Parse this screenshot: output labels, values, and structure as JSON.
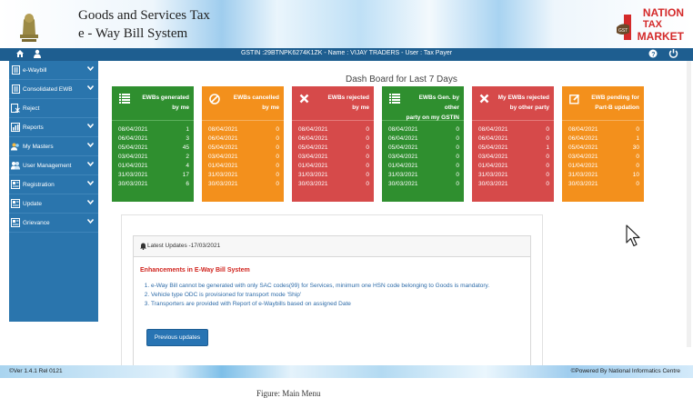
{
  "header": {
    "title_line1": "Goods and Services Tax",
    "title_line2": "e - Way Bill System",
    "logo": {
      "line1": "NATION",
      "line2": "TAX",
      "line3": "MARKET",
      "badge": "GST"
    }
  },
  "navbar": {
    "gstin_info": "GSTIN :29BTNPK6274K1ZK - Name : VIJAY TRADERS - User : Tax Payer",
    "icons": [
      "home-icon",
      "user-icon",
      "help-icon",
      "power-icon"
    ]
  },
  "sidebar": {
    "items": [
      {
        "label": "e-Waybill",
        "icon": "document-icon",
        "chevron": true
      },
      {
        "label": "Consolidated EWB",
        "icon": "document-icon",
        "chevron": true
      },
      {
        "label": "Reject",
        "icon": "reject-icon",
        "chevron": false
      },
      {
        "label": "Reports",
        "icon": "report-icon",
        "chevron": true
      },
      {
        "label": "My Masters",
        "icon": "masters-icon",
        "chevron": true
      },
      {
        "label": "User Management",
        "icon": "users-icon",
        "chevron": true
      },
      {
        "label": "Registration",
        "icon": "registration-icon",
        "chevron": true
      },
      {
        "label": "Update",
        "icon": "update-icon",
        "chevron": true
      },
      {
        "label": "Grievance",
        "icon": "grievance-icon",
        "chevron": true
      }
    ]
  },
  "dashboard": {
    "title": "Dash Board for Last 7 Days",
    "cards": [
      {
        "title_line1": "EWBs generated",
        "title_line2": "by me",
        "color": "#2f8f2f",
        "icon": "list-icon",
        "rows": [
          [
            "08/04/2021",
            "1"
          ],
          [
            "06/04/2021",
            "3"
          ],
          [
            "05/04/2021",
            "45"
          ],
          [
            "03/04/2021",
            "2"
          ],
          [
            "01/04/2021",
            "4"
          ],
          [
            "31/03/2021",
            "17"
          ],
          [
            "30/03/2021",
            "6"
          ]
        ]
      },
      {
        "title_line1": "EWBs cancelled",
        "title_line2": "by me",
        "color": "#f3901c",
        "icon": "cancel-icon",
        "rows": [
          [
            "08/04/2021",
            "0"
          ],
          [
            "06/04/2021",
            "0"
          ],
          [
            "05/04/2021",
            "0"
          ],
          [
            "03/04/2021",
            "0"
          ],
          [
            "01/04/2021",
            "0"
          ],
          [
            "31/03/2021",
            "0"
          ],
          [
            "30/03/2021",
            "0"
          ]
        ]
      },
      {
        "title_line1": "EWBs rejected",
        "title_line2": "by me",
        "color": "#d64a4a",
        "icon": "x-icon",
        "rows": [
          [
            "08/04/2021",
            "0"
          ],
          [
            "06/04/2021",
            "0"
          ],
          [
            "05/04/2021",
            "0"
          ],
          [
            "03/04/2021",
            "0"
          ],
          [
            "01/04/2021",
            "0"
          ],
          [
            "31/03/2021",
            "0"
          ],
          [
            "30/03/2021",
            "0"
          ]
        ]
      },
      {
        "title_line1": "EWBs Gen. by other",
        "title_line2": "party on my GSTIN",
        "color": "#2f8f2f",
        "icon": "list-icon",
        "rows": [
          [
            "08/04/2021",
            "0"
          ],
          [
            "06/04/2021",
            "0"
          ],
          [
            "05/04/2021",
            "0"
          ],
          [
            "03/04/2021",
            "0"
          ],
          [
            "01/04/2021",
            "0"
          ],
          [
            "31/03/2021",
            "0"
          ],
          [
            "30/03/2021",
            "0"
          ]
        ]
      },
      {
        "title_line1": "My EWBs rejected",
        "title_line2": "by other party",
        "color": "#d64a4a",
        "icon": "x-icon",
        "rows": [
          [
            "08/04/2021",
            "0"
          ],
          [
            "06/04/2021",
            "0"
          ],
          [
            "05/04/2021",
            "1"
          ],
          [
            "03/04/2021",
            "0"
          ],
          [
            "01/04/2021",
            "0"
          ],
          [
            "31/03/2021",
            "0"
          ],
          [
            "30/03/2021",
            "0"
          ]
        ]
      },
      {
        "title_line1": "EWB pending for",
        "title_line2": "Part-B updation",
        "color": "#f3901c",
        "icon": "edit-icon",
        "rows": [
          [
            "08/04/2021",
            "0"
          ],
          [
            "06/04/2021",
            "1"
          ],
          [
            "05/04/2021",
            "30"
          ],
          [
            "03/04/2021",
            "0"
          ],
          [
            "01/04/2021",
            "0"
          ],
          [
            "31/03/2021",
            "10"
          ],
          [
            "30/03/2021",
            "0"
          ]
        ]
      }
    ]
  },
  "updates": {
    "header": "Latest Updates -17/03/2021",
    "heading": "Enhancements in E-Way Bill System",
    "items": [
      "e-Way Bill cannot be generated with only SAC codes(99) for Services, minimum one HSN code belonging to Goods is mandatory.",
      "Vehicle type ODC is provisioned for transport mode 'Ship'",
      "Transporters are provided with Report of e-Waybills based on assigned Date"
    ],
    "button_label": "Previous updates"
  },
  "footer": {
    "version": "Ver 1.4.1 Rel 0121",
    "powered": "Powered By National Informatics Centre"
  },
  "caption": "Figure: Main Menu"
}
